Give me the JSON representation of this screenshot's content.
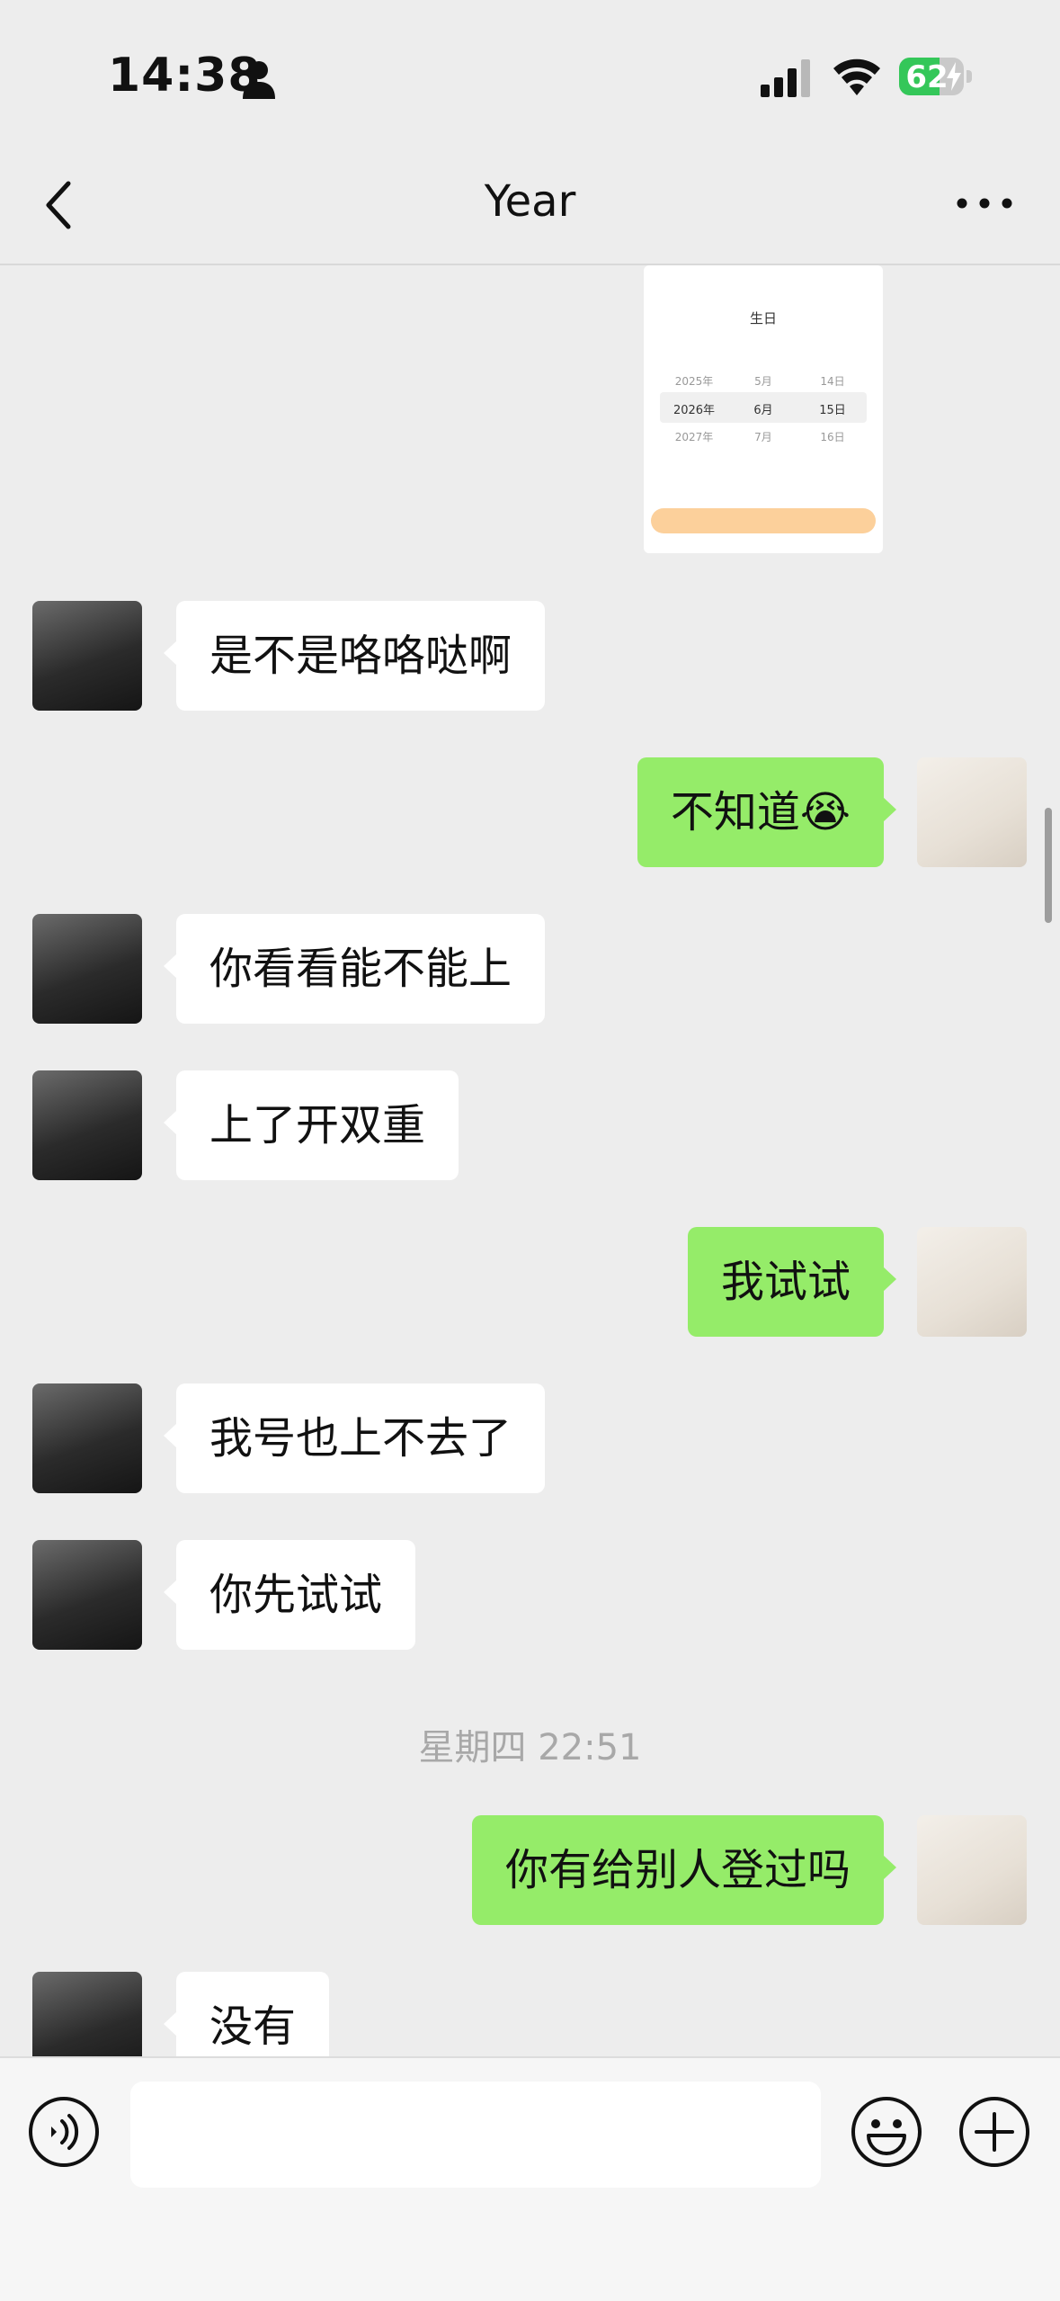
{
  "status_bar": {
    "time": "14:38",
    "battery": "62",
    "battery_level": 0.62
  },
  "header": {
    "title": "Year"
  },
  "image_message": {
    "title": "生日",
    "picker_rows": [
      {
        "y": "2025年",
        "m": "5月",
        "d": "14日"
      },
      {
        "y": "2026年",
        "m": "6月",
        "d": "15日"
      },
      {
        "y": "2027年",
        "m": "7月",
        "d": "16日"
      }
    ]
  },
  "messages": [
    {
      "side": "in",
      "text": "是不是咯咯哒啊"
    },
    {
      "side": "out",
      "text": "不知道😭"
    },
    {
      "side": "in",
      "text": "你看看能不能上"
    },
    {
      "side": "in",
      "text": "上了开双重"
    },
    {
      "side": "out",
      "text": "我试试"
    },
    {
      "side": "in",
      "text": "我号也上不去了"
    },
    {
      "side": "in",
      "text": "你先试试"
    },
    {
      "side": "out",
      "text": "你有给别人登过吗"
    },
    {
      "side": "in",
      "text": "没有"
    }
  ],
  "timestamp": "星期四 22:51",
  "input": {
    "value": ""
  },
  "icons": {
    "back": "chevron-left-icon",
    "more": "more-dots-icon",
    "voice": "voice-icon",
    "emoji": "emoji-icon",
    "plus": "plus-icon"
  },
  "colors": {
    "background": "#ededed",
    "outgoing_bubble": "#95ec69",
    "incoming_bubble": "#ffffff",
    "battery": "#34c759"
  }
}
